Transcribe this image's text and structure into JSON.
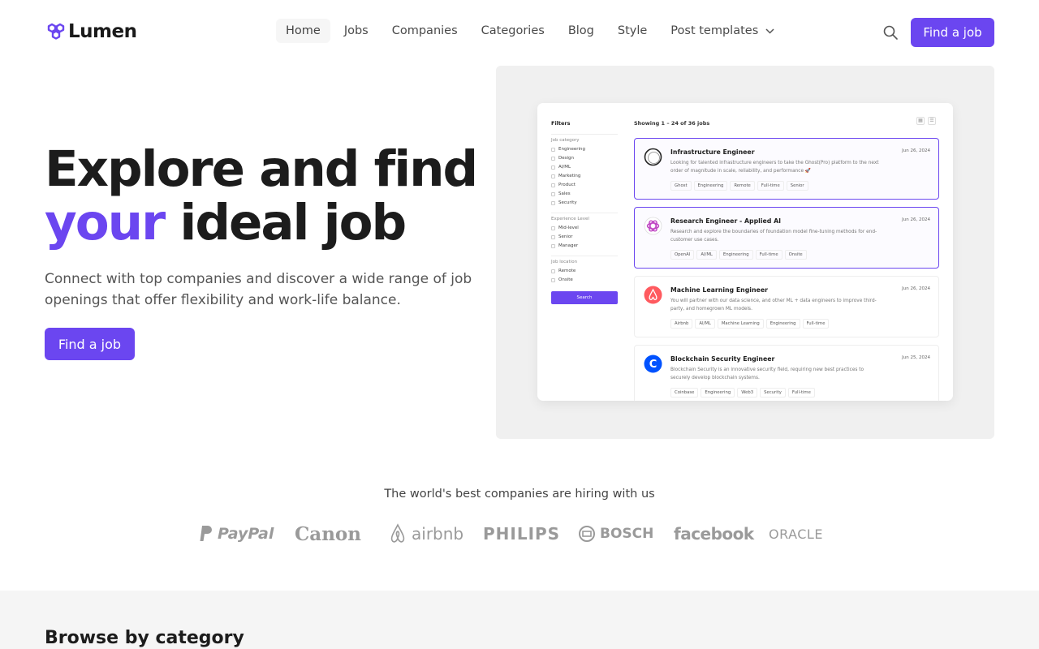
{
  "brand": {
    "name": "Lumen",
    "accent": "#6b46f0"
  },
  "nav": {
    "items": [
      "Home",
      "Jobs",
      "Companies",
      "Categories",
      "Blog",
      "Style",
      "Post templates"
    ],
    "cta": "Find a job"
  },
  "hero": {
    "title_line1": "Explore and find",
    "title_accent": "your",
    "title_rest": " ideal job",
    "subtitle": "Connect with top companies and discover a wide range of job openings that offer flexibility and work-life balance.",
    "cta": "Find a job"
  },
  "preview": {
    "filters_title": "Filters",
    "group_category": "Job category",
    "categories": [
      "Engineering",
      "Design",
      "AI/ML",
      "Marketing",
      "Product",
      "Sales",
      "Security"
    ],
    "group_level": "Experience Level",
    "levels": [
      "Mid-level",
      "Senior",
      "Manager"
    ],
    "group_location": "Job location",
    "locations": [
      "Remote",
      "Onsite"
    ],
    "search": "Search",
    "showing": "Showing 1 – 24 of 36 jobs",
    "jobs": [
      {
        "title": "Infrastructure Engineer",
        "date": "Jun 26, 2024",
        "desc": "Looking for talented infrastructure engineers to take the Ghost(Pro) platform to the next order of magnitude in scale, reliability, and performance 🚀",
        "tags": [
          "Ghost",
          "Engineering",
          "Remote",
          "Full-time",
          "Senior"
        ],
        "logo_color": "#ffffff"
      },
      {
        "title": "Research Engineer - Applied AI",
        "date": "Jun 26, 2024",
        "desc": "Research and explore the boundaries of foundation model fine-tuning methods for end-customer use cases.",
        "tags": [
          "OpenAI",
          "AI/ML",
          "Engineering",
          "Full-time",
          "Onsite"
        ],
        "logo_color": "#ffffff"
      },
      {
        "title": "Machine Learning Engineer",
        "date": "Jun 26, 2024",
        "desc": "You will partner with our data science, and other ML + data engineers to improve third-party, and homegrown ML models.",
        "tags": [
          "Airbnb",
          "AI/ML",
          "Machine Learning",
          "Engineering",
          "Full-time"
        ],
        "logo_color": "#ff5a5f"
      },
      {
        "title": "Blockchain Security Engineer",
        "date": "Jun 25, 2024",
        "desc": "Blockchain Security is an innovative security field, requiring new best practices to securely develop blockchain systems.",
        "tags": [
          "Coinbase",
          "Engineering",
          "Web3",
          "Security",
          "Full-time"
        ],
        "logo_color": "#0052ff"
      }
    ]
  },
  "companies": {
    "title": "The world's best companies are hiring with us",
    "logos": [
      "PayPal",
      "Canon",
      "airbnb",
      "PHILIPS",
      "BOSCH",
      "facebook",
      "ORACLE"
    ]
  },
  "browse": {
    "title": "Browse by category"
  }
}
